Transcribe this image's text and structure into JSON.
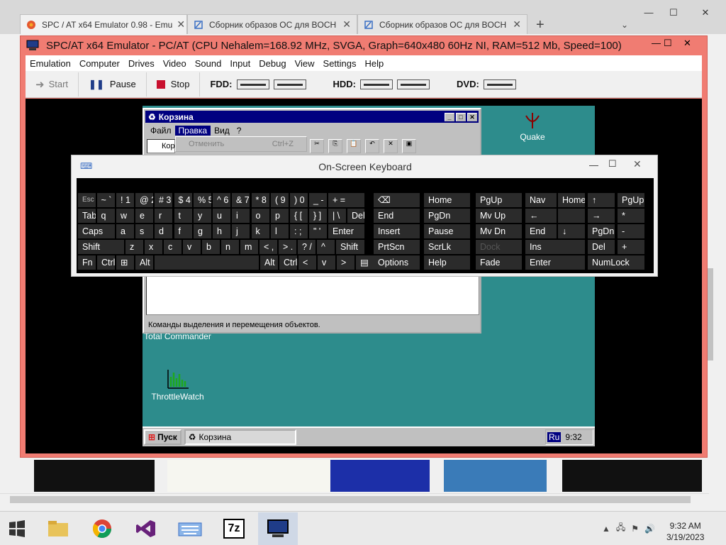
{
  "browser": {
    "tabs": [
      {
        "label": "SPC / AT x64 Emulator 0.98 - Emu"
      },
      {
        "label": "Сборник образов ОС для BOCH"
      },
      {
        "label": "Сборник образов ОС для BOCH"
      }
    ],
    "new_tab": "+"
  },
  "emulator": {
    "title": "SPC/AT x64 Emulator - PC/AT (CPU Nehalem=168.92 MHz, SVGA, Graph=640x480 60Hz NI, RAM=512 Mb, Speed=100)",
    "menu": [
      "Emulation",
      "Computer",
      "Drives",
      "Video",
      "Sound",
      "Input",
      "Debug",
      "View",
      "Settings",
      "Help"
    ],
    "toolbar": {
      "start": "Start",
      "pause": "Pause",
      "stop": "Stop",
      "fdd": "FDD:",
      "hdd": "HDD:",
      "dvd": "DVD:"
    }
  },
  "win95": {
    "window_title": "Корзина",
    "menu": [
      "Файл",
      "Правка",
      "Вид",
      "?"
    ],
    "dropdown_item": "Отменить",
    "dropdown_shortcut": "Ctrl+Z",
    "address": "Кор",
    "status": "Команды выделения и перемещения объектов.",
    "desktop_icons": [
      "Quake",
      "Total Commander",
      "ThrottleWatch"
    ],
    "start": "Пуск",
    "task_item": "Корзина",
    "lang": "Ru",
    "time": "9:32"
  },
  "osk": {
    "title": "On-Screen Keyboard",
    "rows": [
      [
        "Esc",
        "~ `",
        "! 1",
        "@ 2",
        "# 3",
        "$ 4",
        "% 5",
        "^ 6",
        "& 7",
        "* 8",
        "( 9",
        ") 0",
        "_ -",
        "+ =",
        "⌫",
        "Home",
        "PgUp",
        "Nav",
        "Home",
        "↑",
        "PgUp",
        "/"
      ],
      [
        "Tab",
        "q",
        "w",
        "e",
        "r",
        "t",
        "y",
        "u",
        "i",
        "o",
        "p",
        "{ [",
        "} ]",
        "| \\",
        "Del",
        "End",
        "PgDn",
        "Mv Up",
        "←",
        "",
        "→",
        "*"
      ],
      [
        "Caps",
        "a",
        "s",
        "d",
        "f",
        "g",
        "h",
        "j",
        "k",
        "l",
        ": ;",
        "\" '",
        "Enter",
        "Insert",
        "Pause",
        "Mv Dn",
        "End",
        "↓",
        "PgDn",
        "-"
      ],
      [
        "Shift",
        "z",
        "x",
        "c",
        "v",
        "b",
        "n",
        "m",
        "< ,",
        "> .",
        "? /",
        "^",
        "Shift",
        "PrtScn",
        "ScrLk",
        "Dock",
        "Ins",
        "Del",
        "+"
      ],
      [
        "Fn",
        "Ctrl",
        "⊞",
        "Alt",
        "Alt",
        "Ctrl",
        "<",
        "v",
        ">",
        "▤",
        "Options",
        "Help",
        "Fade",
        "Enter",
        "NumLock"
      ]
    ]
  },
  "taskbar": {
    "clock_time": "9:32 AM",
    "clock_date": "3/19/2023"
  }
}
